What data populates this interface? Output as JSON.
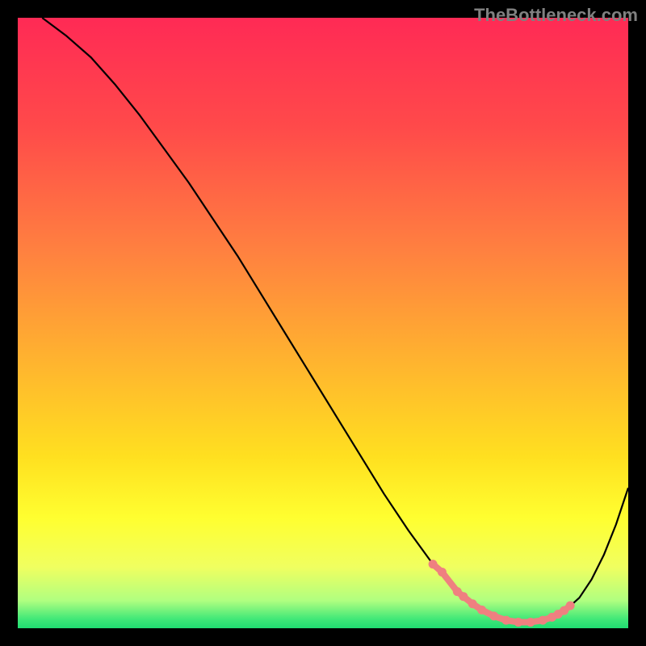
{
  "watermark": "TheBottleneck.com",
  "chart_data": {
    "type": "line",
    "title": "",
    "xlabel": "",
    "ylabel": "",
    "xlim": [
      0,
      100
    ],
    "ylim": [
      0,
      100
    ],
    "background_gradient": {
      "stops": [
        {
          "offset": 0.0,
          "color": "#ff2a55"
        },
        {
          "offset": 0.18,
          "color": "#ff4a4a"
        },
        {
          "offset": 0.38,
          "color": "#ff8040"
        },
        {
          "offset": 0.55,
          "color": "#ffb030"
        },
        {
          "offset": 0.72,
          "color": "#ffe020"
        },
        {
          "offset": 0.82,
          "color": "#ffff30"
        },
        {
          "offset": 0.9,
          "color": "#f0ff60"
        },
        {
          "offset": 0.955,
          "color": "#b0ff80"
        },
        {
          "offset": 0.985,
          "color": "#40e878"
        },
        {
          "offset": 1.0,
          "color": "#20dd72"
        }
      ]
    },
    "series": [
      {
        "name": "bottleneck-curve",
        "color": "#000000",
        "width": 2.2,
        "x": [
          4,
          8,
          12,
          16,
          20,
          24,
          28,
          32,
          36,
          40,
          44,
          48,
          52,
          56,
          60,
          64,
          68,
          70,
          72,
          74,
          76,
          78,
          80,
          82,
          84,
          86,
          88,
          90,
          92,
          94,
          96,
          98,
          100
        ],
        "y": [
          100,
          97,
          93.5,
          89,
          84,
          78.5,
          73,
          67,
          61,
          54.5,
          48,
          41.5,
          35,
          28.5,
          22,
          16,
          10.5,
          8,
          6,
          4.3,
          3,
          2,
          1.3,
          1,
          1,
          1.3,
          2,
          3.2,
          5,
          8,
          12,
          17,
          23
        ]
      }
    ],
    "highlight": {
      "color": "#ef8080",
      "point_radius": 5.5,
      "segment_width": 8,
      "points_x": [
        68,
        69.5,
        72,
        73,
        74.5,
        76,
        78,
        80,
        82,
        84,
        86,
        87.5,
        88.5,
        89.5,
        90.5
      ],
      "points_y": [
        10.5,
        9.2,
        6,
        5.2,
        4,
        3,
        2,
        1.3,
        1,
        1,
        1.3,
        1.8,
        2.3,
        2.9,
        3.7
      ]
    }
  }
}
